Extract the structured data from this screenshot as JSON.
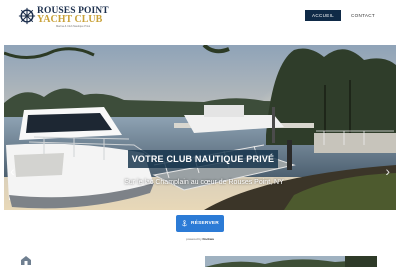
{
  "logo": {
    "line1": "ROUSES POINT",
    "line2": "YACHT CLUB",
    "tagline": "Marina & Club Nautique Privé"
  },
  "nav": {
    "items": [
      {
        "label": "ACCUEIL",
        "active": true
      },
      {
        "label": "CONTACT",
        "active": false
      }
    ]
  },
  "hero": {
    "title": "VOTRE CLUB NAUTIQUE PRIVÉ",
    "subtitle": "Sur le lac Champlain au cœur de Rouses Point, NY"
  },
  "reserve": {
    "label": "RÉSERVER",
    "powered_prefix": "powered by",
    "powered_brand": "Dockwa"
  },
  "colors": {
    "navy": "#0f2a47",
    "gold": "#c9a23a",
    "button_blue": "#2c7bd6"
  }
}
